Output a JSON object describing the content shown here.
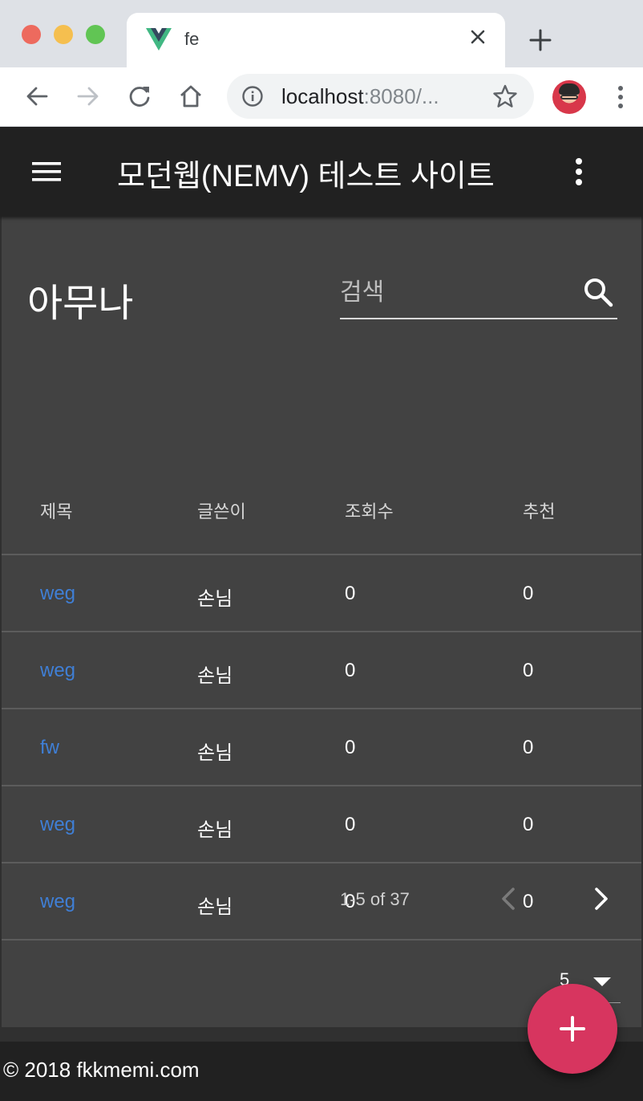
{
  "browser": {
    "tab_title": "fe",
    "url_host": "localhost",
    "url_rest": ":8080/..."
  },
  "app_bar": {
    "title": "모던웹(NEMV) 테스트 사이트"
  },
  "board": {
    "title": "아무나",
    "search_placeholder": "검색",
    "columns": [
      "제목",
      "글쓴이",
      "조회수",
      "추천"
    ],
    "rows": [
      {
        "title": "weg",
        "author": "손님",
        "views": "0",
        "likes": "0"
      },
      {
        "title": "weg",
        "author": "손님",
        "views": "0",
        "likes": "0"
      },
      {
        "title": "fw",
        "author": "손님",
        "views": "0",
        "likes": "0"
      },
      {
        "title": "weg",
        "author": "손님",
        "views": "0",
        "likes": "0"
      },
      {
        "title": "weg",
        "author": "손님",
        "views": "0",
        "likes": "0"
      }
    ],
    "pagination": {
      "range": "1-5 of 37",
      "rows_per_page": "5"
    }
  },
  "footer": {
    "text": "© 2018 fkkmemi.com"
  },
  "colors": {
    "app_bar": "#212121",
    "card": "#424242",
    "link": "#3f7fd6",
    "fab": "#d7355f"
  },
  "icons": {
    "menu": "hamburger-icon",
    "app_more": "more-vert-icon",
    "search": "search-icon",
    "prev": "chevron-left-icon",
    "next": "chevron-right-icon",
    "rows_per_page": "caret-down-icon",
    "fab": "add-icon"
  }
}
